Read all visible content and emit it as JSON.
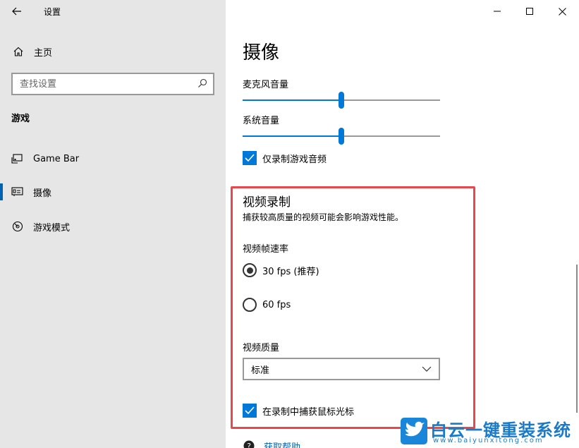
{
  "window": {
    "title": "设置",
    "controls": [
      "minimize-icon",
      "maximize-icon",
      "close-icon"
    ]
  },
  "nav": {
    "home_label": "主页",
    "search_placeholder": "查找设置",
    "section_heading": "游戏",
    "items": [
      {
        "label": "Game Bar",
        "icon": "game-bar-icon",
        "selected": false
      },
      {
        "label": "摄像",
        "icon": "capture-icon",
        "selected": true
      },
      {
        "label": "游戏模式",
        "icon": "game-mode-icon",
        "selected": false
      }
    ]
  },
  "main": {
    "title": "摄像",
    "mic_volume": {
      "label": "麦克风音量",
      "value_fraction": 0.5
    },
    "system_volume": {
      "label": "系统音量",
      "value_fraction": 0.5
    },
    "game_audio_only": {
      "label": "仅录制游戏音频",
      "checked": true
    },
    "video": {
      "title": "视频录制",
      "description": "捕获较高质量的视频可能会影响游戏性能。",
      "frame_rate_label": "视频帧速率",
      "frame_rates": [
        {
          "label": "30 fps (推荐)",
          "selected": true
        },
        {
          "label": "60 fps",
          "selected": false
        }
      ],
      "quality_label": "视频质量",
      "quality_value": "标准",
      "capture_cursor": {
        "label": "在录制中捕获鼠标光标",
        "checked": true
      }
    },
    "help_label": "获取帮助"
  },
  "watermark": {
    "text": "白云一键重装系统",
    "url": "www.baiyunxitong.com"
  },
  "colors": {
    "accent": "#0078d7",
    "highlight_border": "#e8474e",
    "nav_bg": "#e6e6e6"
  }
}
